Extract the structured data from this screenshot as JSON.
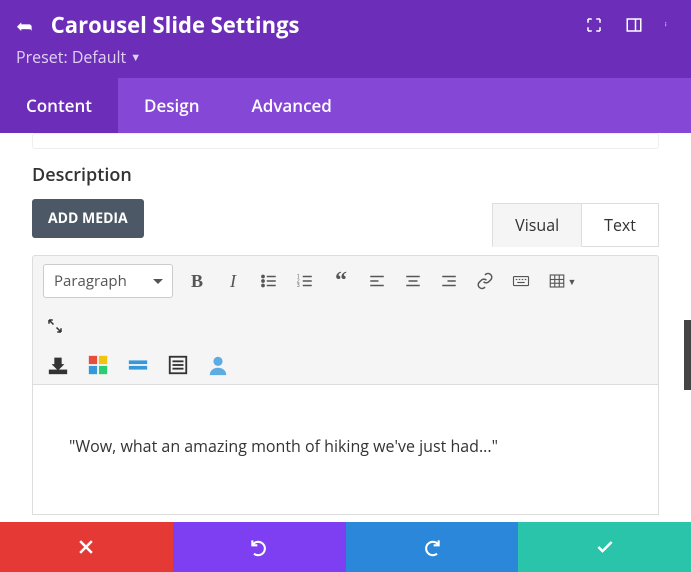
{
  "header": {
    "title": "Carousel Slide Settings",
    "preset_label": "Preset: Default"
  },
  "tabs": {
    "content": "Content",
    "design": "Design",
    "advanced": "Advanced"
  },
  "section": {
    "description_label": "Description",
    "add_media": "ADD MEDIA"
  },
  "editor_tabs": {
    "visual": "Visual",
    "text": "Text"
  },
  "toolbar": {
    "format": "Paragraph"
  },
  "editor": {
    "content": "\"Wow, what an amazing month of hiking we've just had...\""
  }
}
